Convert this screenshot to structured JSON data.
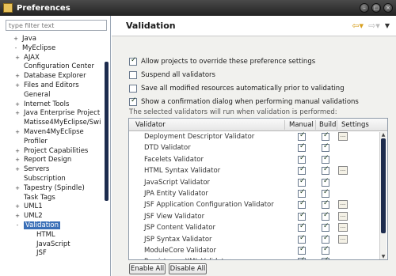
{
  "window": {
    "title": "Preferences"
  },
  "filter": {
    "placeholder": "type filter text"
  },
  "tree": [
    {
      "label": "Java",
      "level": 1,
      "toggle": "+"
    },
    {
      "label": "MyEclipse",
      "level": 1,
      "toggle": "-"
    },
    {
      "label": "AJAX",
      "level": 2,
      "toggle": "+"
    },
    {
      "label": "Configuration Center",
      "level": 2,
      "toggle": ""
    },
    {
      "label": "Database Explorer",
      "level": 2,
      "toggle": "+"
    },
    {
      "label": "Files and Editors",
      "level": 2,
      "toggle": "+"
    },
    {
      "label": "General",
      "level": 2,
      "toggle": ""
    },
    {
      "label": "Internet Tools",
      "level": 2,
      "toggle": "+"
    },
    {
      "label": "Java Enterprise Project",
      "level": 2,
      "toggle": "+"
    },
    {
      "label": "Matisse4MyEclipse/Swi",
      "level": 2,
      "toggle": ""
    },
    {
      "label": "Maven4MyEclipse",
      "level": 2,
      "toggle": "+"
    },
    {
      "label": "Profiler",
      "level": 2,
      "toggle": ""
    },
    {
      "label": "Project Capabilities",
      "level": 2,
      "toggle": "+"
    },
    {
      "label": "Report Design",
      "level": 2,
      "toggle": "+"
    },
    {
      "label": "Servers",
      "level": 2,
      "toggle": "+"
    },
    {
      "label": "Subscription",
      "level": 2,
      "toggle": ""
    },
    {
      "label": "Tapestry (Spindle)",
      "level": 2,
      "toggle": "+"
    },
    {
      "label": "Task Tags",
      "level": 2,
      "toggle": ""
    },
    {
      "label": "UML1",
      "level": 2,
      "toggle": "+"
    },
    {
      "label": "UML2",
      "level": 2,
      "toggle": "+"
    },
    {
      "label": "Validation",
      "level": 2,
      "toggle": "-",
      "selected": true
    },
    {
      "label": "HTML",
      "level": 3,
      "toggle": ""
    },
    {
      "label": "JavaScript",
      "level": 3,
      "toggle": ""
    },
    {
      "label": "JSF",
      "level": 3,
      "toggle": ""
    }
  ],
  "page": {
    "title": "Validation",
    "options": [
      {
        "label": "Allow projects to override these preference settings",
        "checked": true
      },
      {
        "label": "Suspend all validators",
        "checked": false
      },
      {
        "label": "Save all modified resources automatically prior to validating",
        "checked": false
      },
      {
        "label": "Show a confirmation dialog when performing manual validations",
        "checked": true
      }
    ],
    "note": "The selected validators will run when validation is performed:"
  },
  "table": {
    "columns": [
      "Validator",
      "Manual",
      "Build",
      "Settings"
    ],
    "rows": [
      {
        "name": "Deployment Descriptor Validator",
        "manual": true,
        "build": true,
        "settings": true
      },
      {
        "name": "DTD Validator",
        "manual": true,
        "build": true,
        "settings": false
      },
      {
        "name": "Facelets Validator",
        "manual": true,
        "build": true,
        "settings": false
      },
      {
        "name": "HTML Syntax Validator",
        "manual": true,
        "build": true,
        "settings": true
      },
      {
        "name": "JavaScript Validator",
        "manual": true,
        "build": true,
        "settings": false
      },
      {
        "name": "JPA Entity Validator",
        "manual": true,
        "build": true,
        "settings": false
      },
      {
        "name": "JSF Application Configuration Validator",
        "manual": true,
        "build": true,
        "settings": true
      },
      {
        "name": "JSF View Validator",
        "manual": true,
        "build": true,
        "settings": true
      },
      {
        "name": "JSP Content Validator",
        "manual": true,
        "build": true,
        "settings": true
      },
      {
        "name": "JSP Syntax Validator",
        "manual": true,
        "build": true,
        "settings": true
      },
      {
        "name": "ModuleCore Validator",
        "manual": true,
        "build": true,
        "settings": false
      },
      {
        "name": "Persistence XML Validator",
        "manual": true,
        "build": true,
        "settings": false
      }
    ],
    "settings_glyph": "..."
  },
  "buttons": {
    "enable_all": "Enable All",
    "disable_all": "Disable All"
  }
}
